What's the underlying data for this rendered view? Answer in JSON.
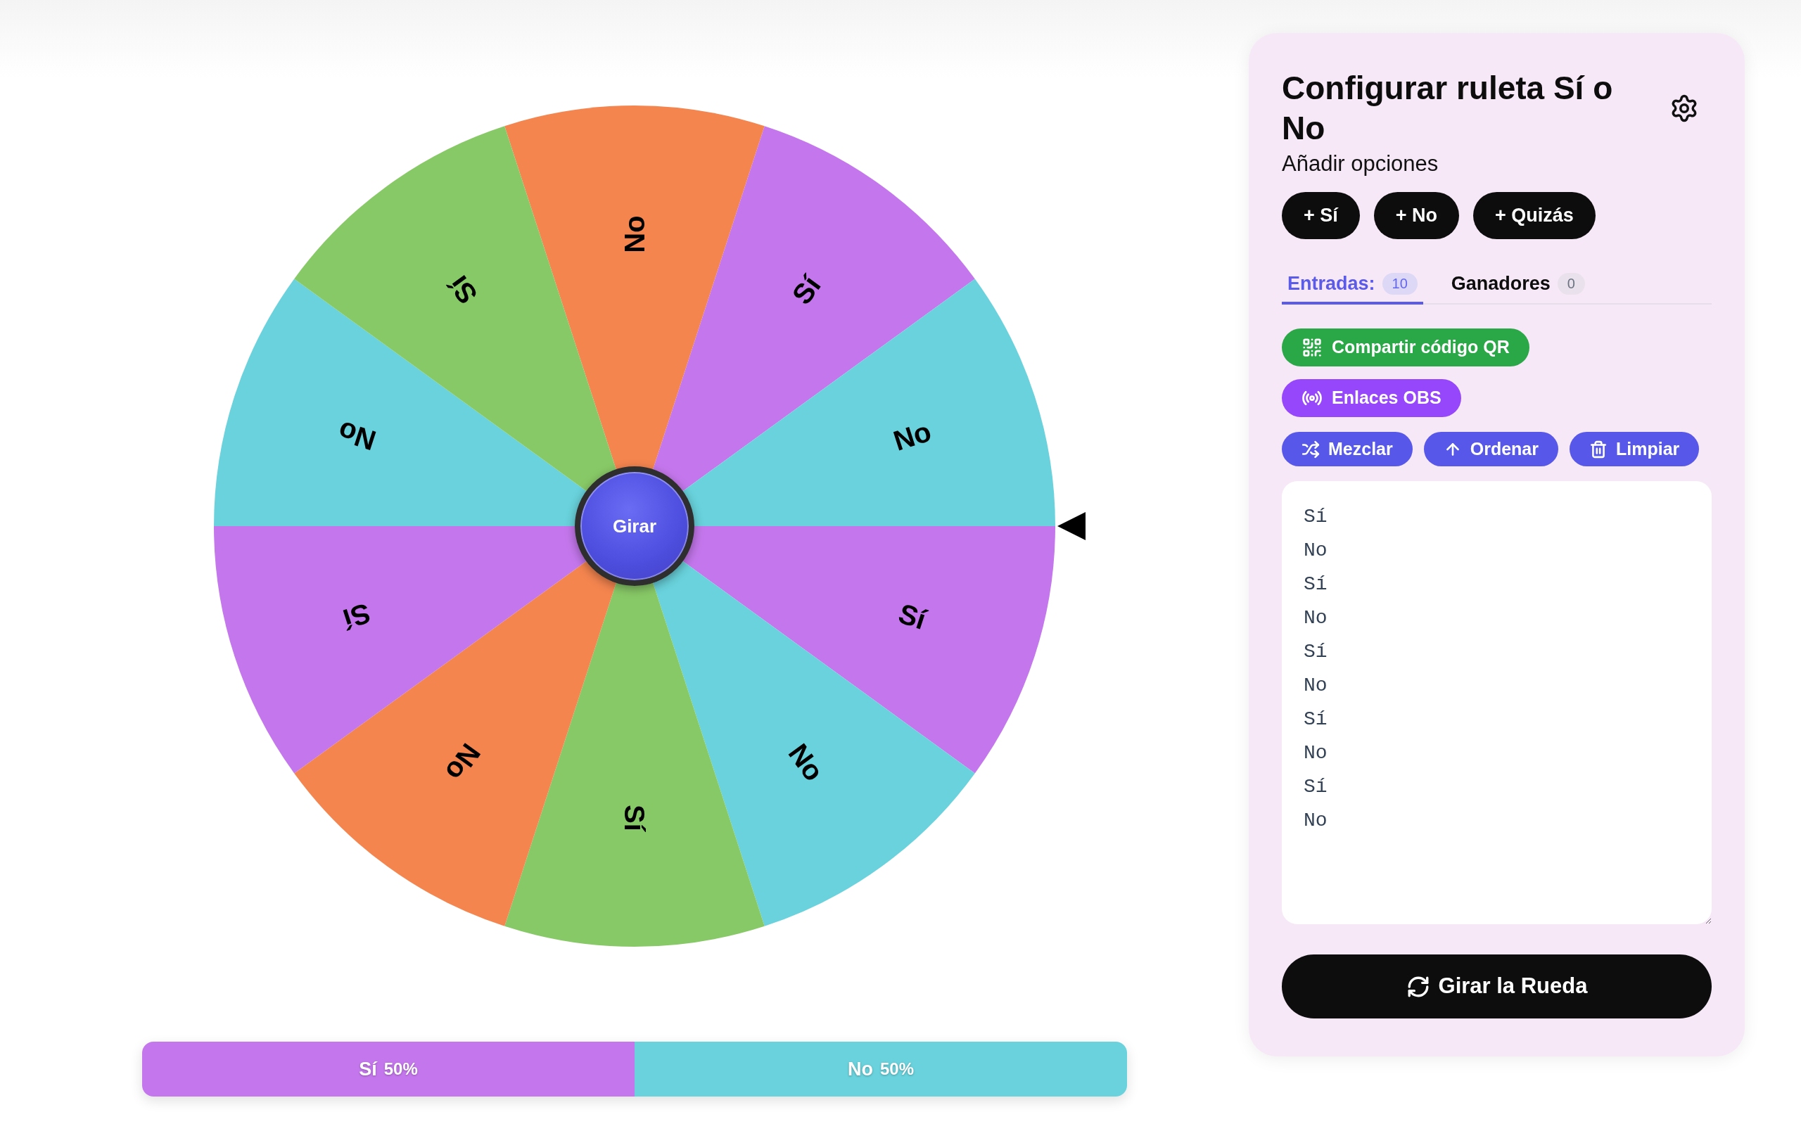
{
  "wheel": {
    "segments": [
      {
        "label": "No",
        "color": "#f4854f"
      },
      {
        "label": "Sí",
        "color": "#c477ec"
      },
      {
        "label": "No",
        "color": "#69d2dc"
      },
      {
        "label": "Sí",
        "color": "#c477ec"
      },
      {
        "label": "No",
        "color": "#69d2dc"
      },
      {
        "label": "Sí",
        "color": "#88c967"
      },
      {
        "label": "No",
        "color": "#f4854f"
      },
      {
        "label": "Sí",
        "color": "#c477ec"
      },
      {
        "label": "No",
        "color": "#69d2dc"
      },
      {
        "label": "Sí",
        "color": "#88c967"
      }
    ],
    "center_button": "Girar"
  },
  "share_bar": {
    "segments": [
      {
        "label": "Sí",
        "value": "50%",
        "color": "#c477ec",
        "level": 0.5
      },
      {
        "label": "No",
        "value": "50%",
        "color": "#69d2dc",
        "level": 0.5
      }
    ]
  },
  "panel": {
    "title": "Configurar ruleta Sí o No",
    "subtitle": "Añadir opciones",
    "add_buttons": [
      "+ Sí",
      "+ No",
      "+ Quizás"
    ],
    "tabs": [
      {
        "label": "Entradas:",
        "count": "10",
        "selected": true
      },
      {
        "label": "Ganadores",
        "count": "0",
        "selected": false
      }
    ],
    "actions": [
      {
        "label": "Compartir código QR",
        "kind": "qr"
      },
      {
        "label": "Enlaces OBS",
        "kind": "obs"
      }
    ],
    "tools": [
      {
        "label": "Mezclar",
        "kind": "shuffle"
      },
      {
        "label": "Ordenar",
        "kind": "sort"
      },
      {
        "label": "Limpiar",
        "kind": "clear"
      }
    ],
    "entries": [
      "Sí",
      "No",
      "Sí",
      "No",
      "Sí",
      "No",
      "Sí",
      "No",
      "Sí",
      "No"
    ],
    "spin_button": "Girar la Rueda"
  }
}
